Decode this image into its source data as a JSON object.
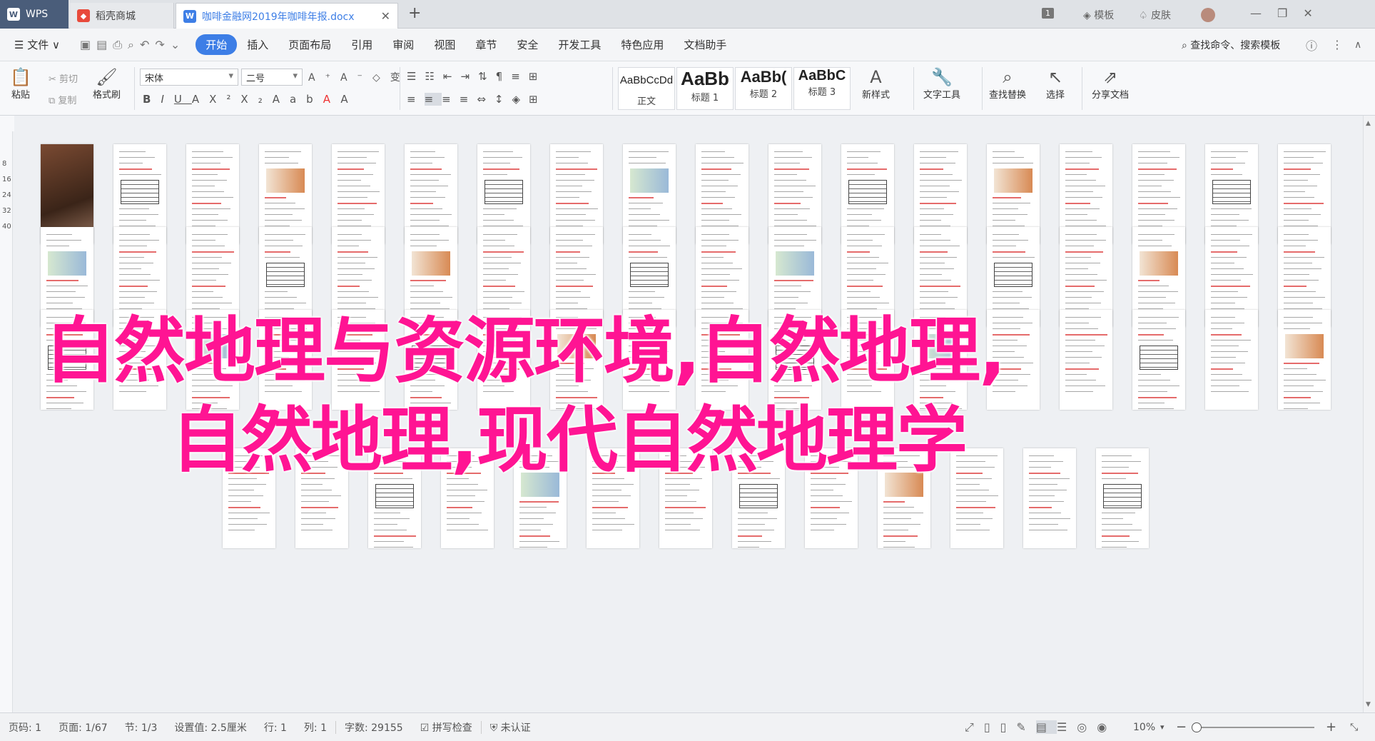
{
  "tabs": {
    "wps": "WPS",
    "store": "稻壳商城",
    "document": "咖啡金融网2019年咖啡年报.docx",
    "new_tab": "+",
    "template": "模板",
    "skin": "皮肤",
    "page_count_badge": "1"
  },
  "menu": {
    "file": "文件",
    "items": [
      "开始",
      "插入",
      "页面布局",
      "引用",
      "审阅",
      "视图",
      "章节",
      "安全",
      "开发工具",
      "特色应用",
      "文档助手"
    ],
    "search": "查找命令、搜索模板"
  },
  "ribbon": {
    "paste": "粘贴",
    "cut": "剪切",
    "copy": "复制",
    "format_painter": "格式刷",
    "font_name": "宋体",
    "font_size": "二号",
    "styles": [
      {
        "sample": "AaBbCcDd",
        "name": "正文"
      },
      {
        "sample": "AaBb",
        "name": "标题 1"
      },
      {
        "sample": "AaBb(",
        "name": "标题 2"
      },
      {
        "sample": "AaBbC",
        "name": "标题 3"
      }
    ],
    "new_style": "新样式",
    "text_tools": "文字工具",
    "find_replace": "查找替换",
    "select": "选择",
    "share": "分享文档"
  },
  "ruler": {
    "v16": "16",
    "v32": "32"
  },
  "vruler": [
    "8",
    "16",
    "24",
    "32",
    "40"
  ],
  "overlay": {
    "line1": "自然地理与资源环境,自然地理,",
    "line2": "自然地理,现代自然地理学"
  },
  "status": {
    "page_num": "页码: 1",
    "page": "页面: 1/67",
    "section": "节: 1/3",
    "setting": "设置值: 2.5厘米",
    "row": "行: 1",
    "col": "列: 1",
    "words": "字数: 29155",
    "spell": "拼写检查",
    "cert": "未认证",
    "zoom": "10%"
  },
  "colors": {
    "accent": "#3d7ee6",
    "overlay_text": "#ff1493"
  }
}
